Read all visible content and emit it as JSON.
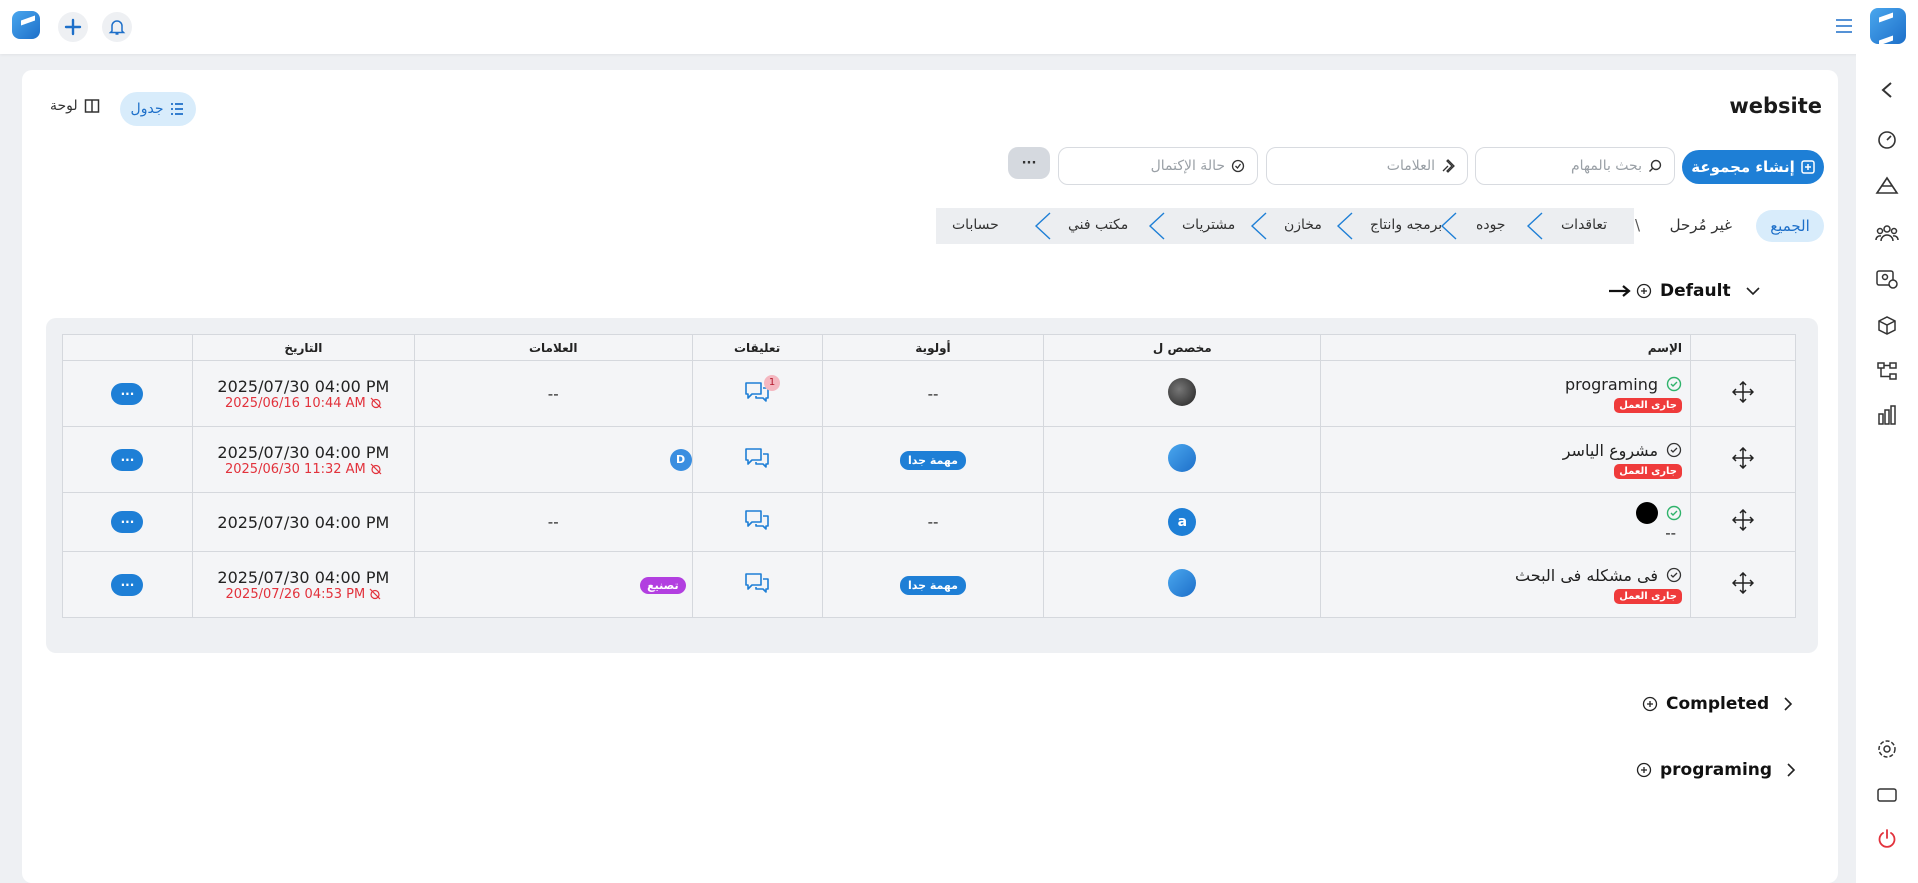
{
  "colors": {
    "accent": "#1e7fd6",
    "danger": "#ef3b3b",
    "tag_purple": "#b23fe0"
  },
  "page": {
    "title": "website"
  },
  "views": {
    "table_label": "جدول",
    "board_label": "لوحة"
  },
  "toolbar": {
    "create_group": "إنشاء مجموعة",
    "search_placeholder": "بحث بالمهام",
    "tags_placeholder": "العلامات",
    "status_placeholder": "حالة الإكتمال",
    "more": "···"
  },
  "tabs": {
    "all": "الجميع",
    "unstaged": "غير مُرحل",
    "separator": "\\",
    "stages": [
      "تعاقدات",
      "جوده",
      "برمجه وانتاج",
      "مخازن",
      "مشتريات",
      "مكتب فني",
      "حسابات"
    ]
  },
  "groups": {
    "default": "Default",
    "completed": "Completed",
    "programing": "programing"
  },
  "table": {
    "headers": {
      "name": "الإسم",
      "assignee": "مخصص ل",
      "priority": "أولوية",
      "comments": "تعليقات",
      "tags": "العلامات",
      "date": "التاريخ"
    },
    "rows": [
      {
        "name": "programing",
        "status": "جارى العمل",
        "priority": "--",
        "comment_count": "1",
        "tags": "--",
        "date": "2025/07/30 04:00 PM",
        "sub_date": "2025/06/16 10:44 AM"
      },
      {
        "name": "مشروع الياسر",
        "status": "جارى العمل",
        "priority": "مهمة جدا",
        "comment_count": "",
        "tags": "D",
        "date": "2025/07/30 04:00 PM",
        "sub_date": "2025/06/30 11:32 AM"
      },
      {
        "name": "--",
        "status": "",
        "priority": "--",
        "comment_count": "",
        "tags": "--",
        "date": "2025/07/30 04:00 PM",
        "sub_date": ""
      },
      {
        "name": "فى مشكله فى البحث",
        "status": "جارى العمل",
        "priority": "مهمة جدا",
        "comment_count": "",
        "tags": "تصنيع",
        "date": "2025/07/30 04:00 PM",
        "sub_date": "2025/07/26 04:53 PM"
      }
    ],
    "row3_avatar": "a",
    "actions": "···"
  },
  "icons": [
    "logo-icon",
    "plus-icon",
    "bell-icon",
    "menu-icon",
    "chevron-left-icon",
    "dashboard-icon",
    "mountain-icon",
    "team-icon",
    "user-settings-icon",
    "box-icon",
    "flow-icon",
    "bar-chart-icon",
    "gear-icon",
    "window-icon",
    "power-icon",
    "move-icon",
    "comment-icon",
    "check-circle-icon",
    "add-circle-icon",
    "arrow-icon"
  ]
}
